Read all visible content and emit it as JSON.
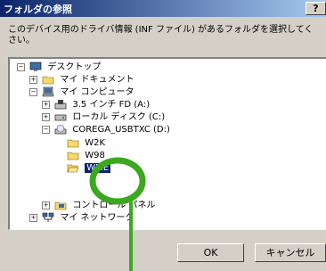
{
  "window": {
    "title": "フォルダの参照",
    "help_label": "?"
  },
  "description": {
    "line1": "このデバイス用のドライバ情報 (INF ファイル) があるフォルダを選択してく",
    "line2": "さい。"
  },
  "tree": [
    {
      "label": "デスクトップ",
      "expander": "−",
      "icon": "desktop-icon"
    },
    {
      "label": "マイ ドキュメント",
      "expander": "+",
      "icon": "folder-icon"
    },
    {
      "label": "マイ コンピュータ",
      "expander": "−",
      "icon": "computer-icon"
    },
    {
      "label": "3.5 インチ FD (A:)",
      "expander": "+",
      "icon": "floppy-drive-icon"
    },
    {
      "label": "ローカル ディスク (C:)",
      "expander": "+",
      "icon": "hard-disk-icon"
    },
    {
      "label": "COREGA_USBTXC (D:)",
      "expander": "−",
      "icon": "cd-drive-icon"
    },
    {
      "label": "W2K",
      "icon": "folder-icon"
    },
    {
      "label": "W98",
      "icon": "folder-icon"
    },
    {
      "label": "WME",
      "icon": "folder-open-icon",
      "selected": true
    },
    {
      "label": "コントロール パネル",
      "expander": "+",
      "icon": "control-panel-icon"
    },
    {
      "label": "マイ ネットワーク",
      "expander": "+",
      "icon": "network-icon"
    }
  ],
  "buttons": {
    "ok": "OK",
    "cancel": "キャンセル"
  },
  "annotation": {
    "color": "#3ca820"
  }
}
